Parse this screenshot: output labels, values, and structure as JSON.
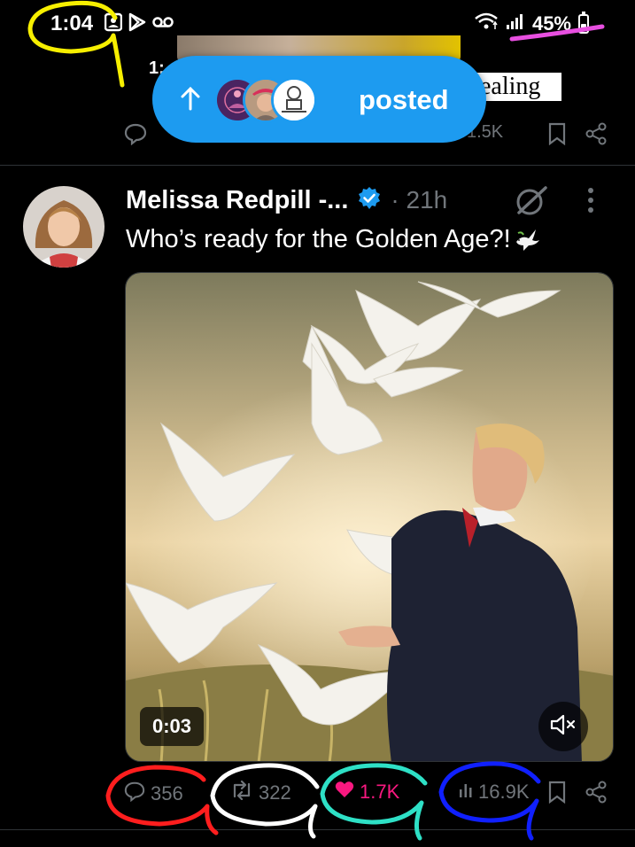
{
  "status_bar": {
    "time": "1:04",
    "battery": "45%",
    "icons": [
      "photo-icon",
      "play-store-icon",
      "voicemail-icon",
      "wifi-icon",
      "signal-icon",
      "battery-icon"
    ]
  },
  "previous_post": {
    "time_fragment": "1:",
    "text_fragment": "ealing",
    "views_fragment": "1.5K"
  },
  "new_posts_pill": {
    "label": "posted"
  },
  "tweet": {
    "author_name": "Melissa Redpill -...",
    "time": "21h",
    "text": "Who’s ready for the Golden Age?!",
    "text_emoji": "dove-emoji",
    "video_timestamp": "0:03",
    "replies": "356",
    "reposts": "322",
    "likes": "1.7K",
    "views": "16.9K"
  },
  "colors": {
    "accent_blue": "#1d9bf0",
    "like_pink": "#f91880",
    "muted": "#71767b",
    "annotation_yellow": "#f7ef00",
    "annotation_magenta": "#e84fe0",
    "annotation_red": "#ff1e1e",
    "annotation_white": "#ffffff",
    "annotation_teal": "#2ee0c6",
    "annotation_blue": "#1020ff"
  }
}
